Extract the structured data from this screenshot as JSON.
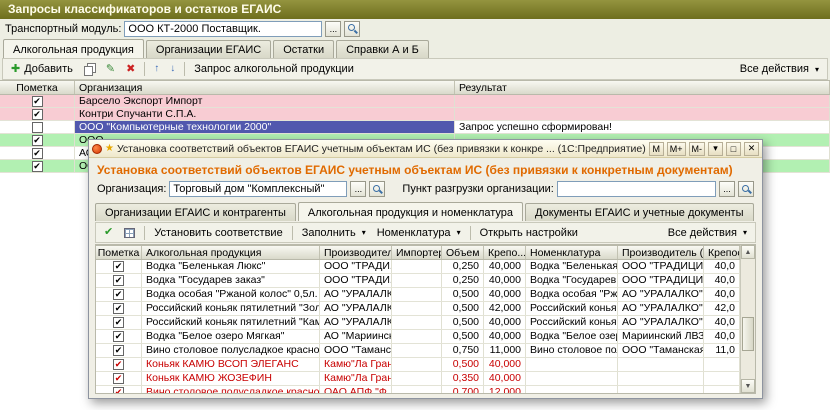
{
  "main_window": {
    "title": "Запросы классификаторов и остатков ЕГАИС",
    "transport_module": {
      "label": "Транспортный модуль:",
      "value": "ООО КТ-2000 Поставщик."
    },
    "tabs": [
      {
        "label": "Алкогольная продукция"
      },
      {
        "label": "Организации ЕГАИС"
      },
      {
        "label": "Остатки"
      },
      {
        "label": "Справки А и Б"
      }
    ],
    "toolbar": {
      "add": "Добавить",
      "request": "Запрос алкогольной продукции",
      "all_actions": "Все действия"
    },
    "table": {
      "columns": [
        "Пометка",
        "Организация",
        "Результат"
      ],
      "rows": [
        {
          "checked": true,
          "org": "Барсело Экспорт Импорт",
          "result": "",
          "bg": "pink"
        },
        {
          "checked": true,
          "org": "Контри Спучанти С.П.А.",
          "result": "",
          "bg": "pink"
        },
        {
          "checked": false,
          "org": "ООО \"Компьютерные технологии 2000\"",
          "result": "Запрос успешно сформирован!",
          "bg": "selected"
        },
        {
          "checked": true,
          "org": "ООО",
          "result": "",
          "bg": "green"
        },
        {
          "checked": true,
          "org": "АО",
          "result": "",
          "bg": "plain"
        },
        {
          "checked": true,
          "org": "ООО",
          "result": "",
          "bg": "green"
        }
      ]
    }
  },
  "dialog": {
    "titlebar": {
      "title": "Установка соответствий объектов ЕГАИС учетным объектам ИС (без привязки к конкретным документам)",
      "suffix": "... (1С:Предприятие)",
      "buttons": [
        "М",
        "М+",
        "М-",
        "▾",
        "□",
        "✕"
      ]
    },
    "heading": "Установка соответствий объектов ЕГАИС учетным объектам ИС (без привязки к конкретным документам)",
    "org_field": {
      "label": "Организация:",
      "value": "Торговый дом \"Комплексный\""
    },
    "unload_field": {
      "label": "Пункт разгрузки организации:",
      "value": ""
    },
    "tabs": [
      {
        "label": "Организации ЕГАИС и контрагенты"
      },
      {
        "label": "Алкогольная продукция и номенклатура"
      },
      {
        "label": "Документы ЕГАИС и учетные документы"
      }
    ],
    "toolbar": {
      "set_match": "Установить соответствие",
      "fill": "Заполнить",
      "nomenclature": "Номенклатура",
      "open_settings": "Открыть настройки",
      "all_actions": "Все действия"
    },
    "table": {
      "columns": [
        "Пометка",
        "Алкогольная продукция",
        "Производитель",
        "Импортер",
        "Объем",
        "Крепо...",
        "Номенклатура",
        "Производитель (алко...",
        "Крепост..."
      ],
      "rows": [
        {
          "checked": true,
          "alc": "Водка \"Беленькая Люкс\"",
          "prod": "ООО \"ТРАДИ...",
          "imp": "",
          "vol": "0,250",
          "str": "40,000",
          "nom": "Водка \"Беленькая Люкс\"",
          "nom_prod": "ООО \"ТРАДИЦИИ К...",
          "nom_str": "40,0",
          "cls": ""
        },
        {
          "checked": true,
          "alc": "Водка \"Государев заказ\"",
          "prod": "ООО \"ТРАДИ...",
          "imp": "",
          "vol": "0,250",
          "str": "40,000",
          "nom": "Водка \"Государев заказ\"",
          "nom_prod": "ООО \"ТРАДИЦИИ К...",
          "nom_str": "40,0",
          "cls": ""
        },
        {
          "checked": true,
          "alc": "Водка особая \"Ржаной колос\" 0,5л.",
          "prod": "АО \"УРАЛАЛК...",
          "imp": "",
          "vol": "0,500",
          "str": "40,000",
          "nom": "Водка особая \"Ржаной кол...",
          "nom_prod": "АО \"УРАЛАЛКО\"",
          "nom_str": "40,0",
          "cls": ""
        },
        {
          "checked": true,
          "alc": "Российский коньяк пятилетний \"Золотой ре...",
          "prod": "АО \"УРАЛАЛК...",
          "imp": "",
          "vol": "0,500",
          "str": "42,000",
          "nom": "Российский коньяк пятиле...",
          "nom_prod": "АО \"УРАЛАЛКО\"",
          "nom_str": "42,0",
          "cls": ""
        },
        {
          "checked": true,
          "alc": "Российский коньяк пятилетний \"Каменный ...",
          "prod": "АО \"УРАЛАЛК...",
          "imp": "",
          "vol": "0,500",
          "str": "40,000",
          "nom": "Российский коньяк пятиле...",
          "nom_prod": "АО \"УРАЛАЛКО\"",
          "nom_str": "40,0",
          "cls": ""
        },
        {
          "checked": true,
          "alc": "Водка \"Белое озеро Мягкая\"",
          "prod": "АО \"Мариинск...",
          "imp": "",
          "vol": "0,500",
          "str": "40,000",
          "nom": "Водка \"Белое озеро Мягк...",
          "nom_prod": "Мариинский ЛВЗ",
          "nom_str": "40,0",
          "cls": ""
        },
        {
          "checked": true,
          "alc": "Вино столовое полусладкое красное \"Кагор ...",
          "prod": "ООО \"Таманс...",
          "imp": "",
          "vol": "0,750",
          "str": "11,000",
          "nom": "Вино столовое полусладк...",
          "nom_prod": "ООО \"Таманская вин...",
          "nom_str": "11,0",
          "cls": ""
        },
        {
          "checked": true,
          "alc": "Коньяк КАМЮ ВСОП ЭЛЕГАНС",
          "prod": "Камю\"Ла Гран...",
          "imp": "",
          "vol": "0,500",
          "str": "40,000",
          "nom": "",
          "nom_prod": "",
          "nom_str": "",
          "cls": "red"
        },
        {
          "checked": true,
          "alc": "Коньяк КАМЮ ЖОЗЕФИН",
          "prod": "Камю\"Ла Гран...",
          "imp": "",
          "vol": "0,350",
          "str": "40,000",
          "nom": "",
          "nom_prod": "",
          "nom_str": "",
          "cls": "red"
        },
        {
          "checked": true,
          "alc": "Вино столовое полусладкое красное \"Черны...",
          "prod": "ОАО АПФ \"Ф...",
          "imp": "",
          "vol": "0,700",
          "str": "12,000",
          "nom": "",
          "nom_prod": "",
          "nom_str": "",
          "cls": "red"
        }
      ]
    }
  }
}
